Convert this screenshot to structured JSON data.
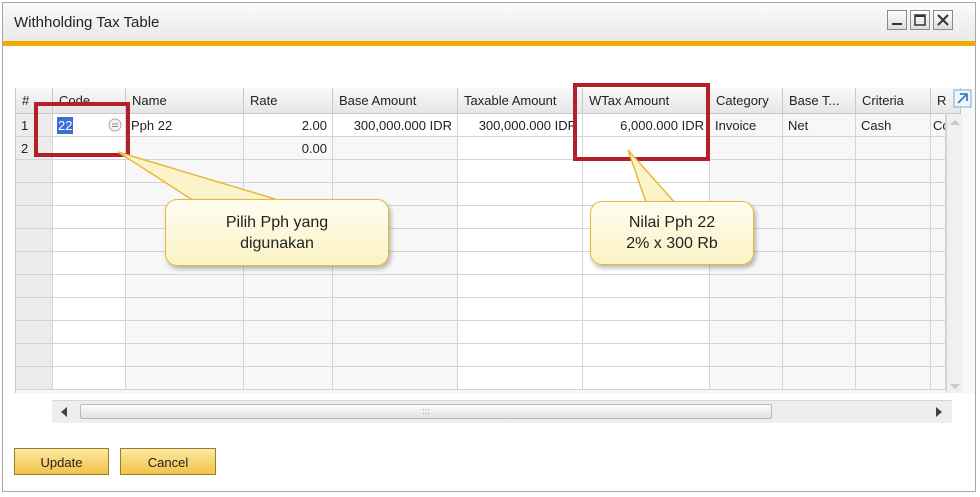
{
  "window": {
    "title": "Withholding Tax Table"
  },
  "columns": [
    "#",
    "Code",
    "Name",
    "Rate",
    "Base Amount",
    "Taxable Amount",
    "WTax Amount",
    "Category",
    "Base T...",
    "Criteria",
    "R"
  ],
  "rows": [
    {
      "num": "1",
      "code": "22",
      "name": "Pph 22",
      "rate": "2.00",
      "base_amount": "300,000.000 IDR",
      "taxable_amount": "300,000.000 IDR",
      "wtax_amount": "6,000.000 IDR",
      "category": "Invoice",
      "base_type": "Net",
      "criteria": "Cash",
      "r": "Co"
    },
    {
      "num": "2",
      "code": "",
      "name": "",
      "rate": "0.00",
      "base_amount": "",
      "taxable_amount": "",
      "wtax_amount": "",
      "category": "",
      "base_type": "",
      "criteria": "",
      "r": ""
    }
  ],
  "scroll_grip": ":::",
  "buttons": {
    "update": "Update",
    "cancel": "Cancel"
  },
  "callouts": {
    "left": {
      "line1": "Pilih Pph yang",
      "line2": "digunakan"
    },
    "right": {
      "line1": "Nilai Pph 22",
      "line2": "2% x 300 Rb"
    }
  },
  "colors": {
    "accent": "#f0ab00",
    "highlight": "#b51f2a",
    "button": "#f3c24a",
    "callout_border": "#e5ba3c"
  }
}
